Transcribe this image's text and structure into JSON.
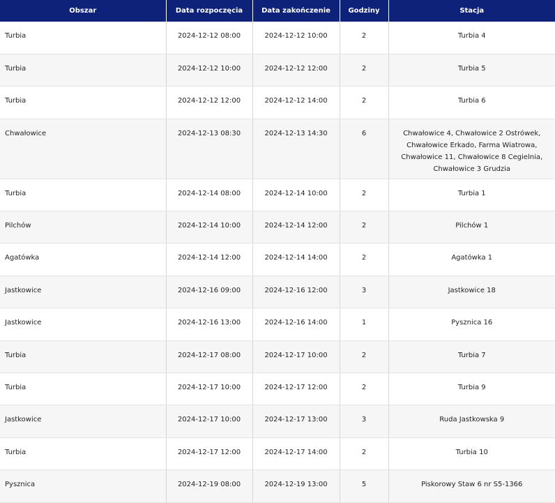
{
  "headers": [
    "Obszar",
    "Data rozpoczęcia",
    "Data zakończenie",
    "Godziny",
    "Stacja"
  ],
  "rows": [
    {
      "area": "Turbia",
      "start": "2024-12-12 08:00",
      "end": "2024-12-12 10:00",
      "hours": "2",
      "station": "Turbia 4"
    },
    {
      "area": "Turbia",
      "start": "2024-12-12 10:00",
      "end": "2024-12-12 12:00",
      "hours": "2",
      "station": "Turbia 5"
    },
    {
      "area": "Turbia",
      "start": "2024-12-12 12:00",
      "end": "2024-12-12 14:00",
      "hours": "2",
      "station": "Turbia 6"
    },
    {
      "area": "Chwałowice",
      "start": "2024-12-13 08:30",
      "end": "2024-12-13 14:30",
      "hours": "6",
      "station": "Chwałowice 4, Chwałowice 2 Ostrówek, Chwałowice Erkado, Farma Wiatrowa, Chwałowice 11, Chwałowice 8 Cegielnia, Chwałowice 3 Grudzia"
    },
    {
      "area": "Turbia",
      "start": "2024-12-14 08:00",
      "end": "2024-12-14 10:00",
      "hours": "2",
      "station": "Turbia 1"
    },
    {
      "area": "Pilchów",
      "start": "2024-12-14 10:00",
      "end": "2024-12-14 12:00",
      "hours": "2",
      "station": "Pilchów 1"
    },
    {
      "area": "Agatówka",
      "start": "2024-12-14 12:00",
      "end": "2024-12-14 14:00",
      "hours": "2",
      "station": "Agatówka 1"
    },
    {
      "area": "Jastkowice",
      "start": "2024-12-16 09:00",
      "end": "2024-12-16 12:00",
      "hours": "3",
      "station": "Jastkowice 18"
    },
    {
      "area": "Jastkowice",
      "start": "2024-12-16 13:00",
      "end": "2024-12-16 14:00",
      "hours": "1",
      "station": "Pysznica 16"
    },
    {
      "area": "Turbia",
      "start": "2024-12-17 08:00",
      "end": "2024-12-17 10:00",
      "hours": "2",
      "station": "Turbia 7"
    },
    {
      "area": "Turbia",
      "start": "2024-12-17 10:00",
      "end": "2024-12-17 12:00",
      "hours": "2",
      "station": "Turbia 9"
    },
    {
      "area": "Jastkowice",
      "start": "2024-12-17 10:00",
      "end": "2024-12-17 13:00",
      "hours": "3",
      "station": "Ruda Jastkowska 9"
    },
    {
      "area": "Turbia",
      "start": "2024-12-17 12:00",
      "end": "2024-12-17 14:00",
      "hours": "2",
      "station": "Turbia 10"
    },
    {
      "area": "Pysznica",
      "start": "2024-12-19 08:00",
      "end": "2024-12-19 13:00",
      "hours": "5",
      "station": "Piskorowy Staw 6 nr S5-1366"
    }
  ]
}
